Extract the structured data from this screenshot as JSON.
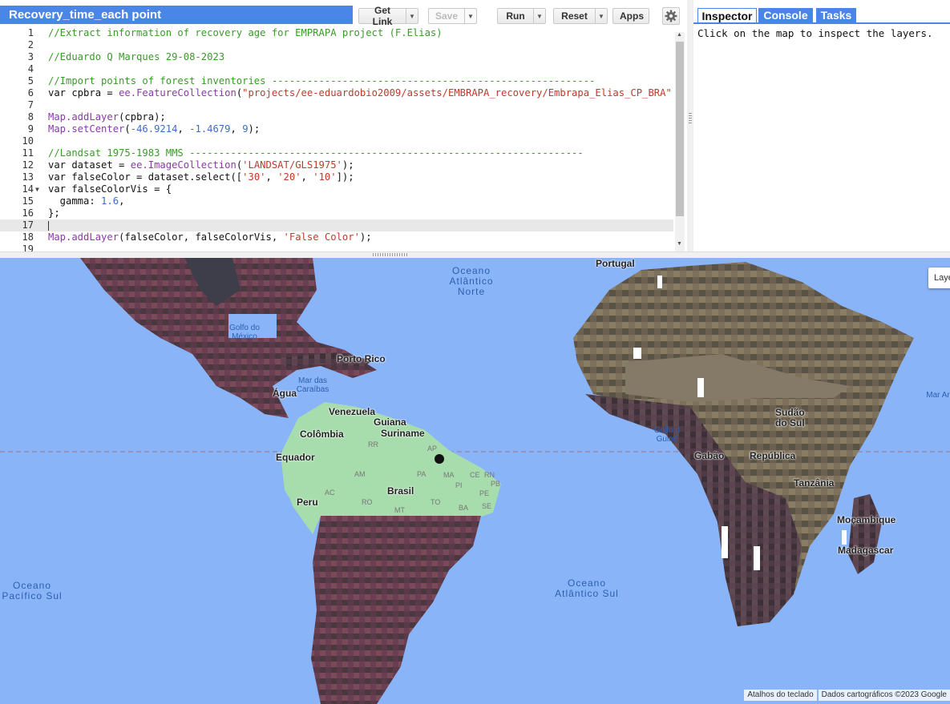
{
  "script_title": "Recovery_time_each point",
  "toolbar": {
    "get_link": "Get Link",
    "save": "Save",
    "run": "Run",
    "reset": "Reset",
    "apps": "Apps"
  },
  "code_lines": [
    {
      "n": "1",
      "t": "//Extract information of recovery age for EMPRAPA project (F.Elias)"
    },
    {
      "n": "2",
      "t": ""
    },
    {
      "n": "3",
      "t": "//Eduardo Q Marques 29-08-2023"
    },
    {
      "n": "4",
      "t": ""
    },
    {
      "n": "5",
      "t": "//Import points of forest inventories -------------------------------------------------------"
    },
    {
      "n": "6",
      "t": "var cpbra = ee.FeatureCollection(\"projects/ee-eduardobio2009/assets/EMBRAPA_recovery/Embrapa_Elias_CP_BRA\");"
    },
    {
      "n": "7",
      "t": ""
    },
    {
      "n": "8",
      "t": "Map.addLayer(cpbra);"
    },
    {
      "n": "9",
      "t": "Map.setCenter(-46.9214, -1.4679, 9);"
    },
    {
      "n": "10",
      "t": ""
    },
    {
      "n": "11",
      "t": "//Landsat 1975-1983 MMS -------------------------------------------------------------------"
    },
    {
      "n": "12",
      "t": "var dataset = ee.ImageCollection('LANDSAT/GLS1975');"
    },
    {
      "n": "13",
      "t": "var falseColor = dataset.select(['30', '20', '10']);"
    },
    {
      "n": "14",
      "t": "var falseColorVis = {"
    },
    {
      "n": "15",
      "t": "  gamma: 1.6,"
    },
    {
      "n": "16",
      "t": "};"
    },
    {
      "n": "17",
      "t": ""
    },
    {
      "n": "18",
      "t": "Map.addLayer(falseColor, falseColorVis, 'False Color');"
    },
    {
      "n": "19",
      "t": ""
    }
  ],
  "tabs": {
    "inspector": "Inspector",
    "console": "Console",
    "tasks": "Tasks"
  },
  "inspector_hint": "Click on the map to inspect the layers.",
  "map": {
    "oceans": {
      "north_atlantic": "Oceano\nAtlântico\nNorte",
      "south_atlantic": "Oceano\nAtlântico Sul",
      "south_pacific": "Oceano\nPacífico Sul"
    },
    "water": {
      "gulf_mexico": "Golfo do\nMéxico",
      "caribbean": "Mar das\nCaraíbas",
      "gulf_guinea": "Golfo d\nGuiné",
      "mar_ar": "Mar Ar"
    },
    "places": {
      "portugal": "Portugal",
      "puerto_rico": "Porto Rico",
      "venezuela": "Venezuela",
      "guiana": "Guiana",
      "colombia": "Colômbia",
      "suriname": "Suriname",
      "equador": "Equador",
      "brasil": "Brasil",
      "peru": "Peru",
      "sudao": "Sudão\ndo Sul",
      "gabao": "Gabão",
      "republica": "República",
      "tanzania": "Tanzânia",
      "madagascar": "Madagascar",
      "mozambique": "Moçambique",
      "agua": "Água"
    },
    "states": [
      "RR",
      "AM",
      "PA",
      "MA",
      "CE",
      "RN",
      "PB",
      "PE",
      "PI",
      "AC",
      "RO",
      "TO",
      "SE",
      "MT",
      "BA",
      "AP"
    ],
    "layers_button": "Layers",
    "attribution": {
      "shortcuts": "Atalhos do teclado",
      "data": "Dados cartográficos ©2023 Google"
    }
  },
  "colors": {
    "accent": "#4a86e8",
    "ocean": "#8ab4f8",
    "land_green": "#a7dcad",
    "comment": "#3a9a2a",
    "string": "#c0392b",
    "number": "#3a6fc4"
  }
}
